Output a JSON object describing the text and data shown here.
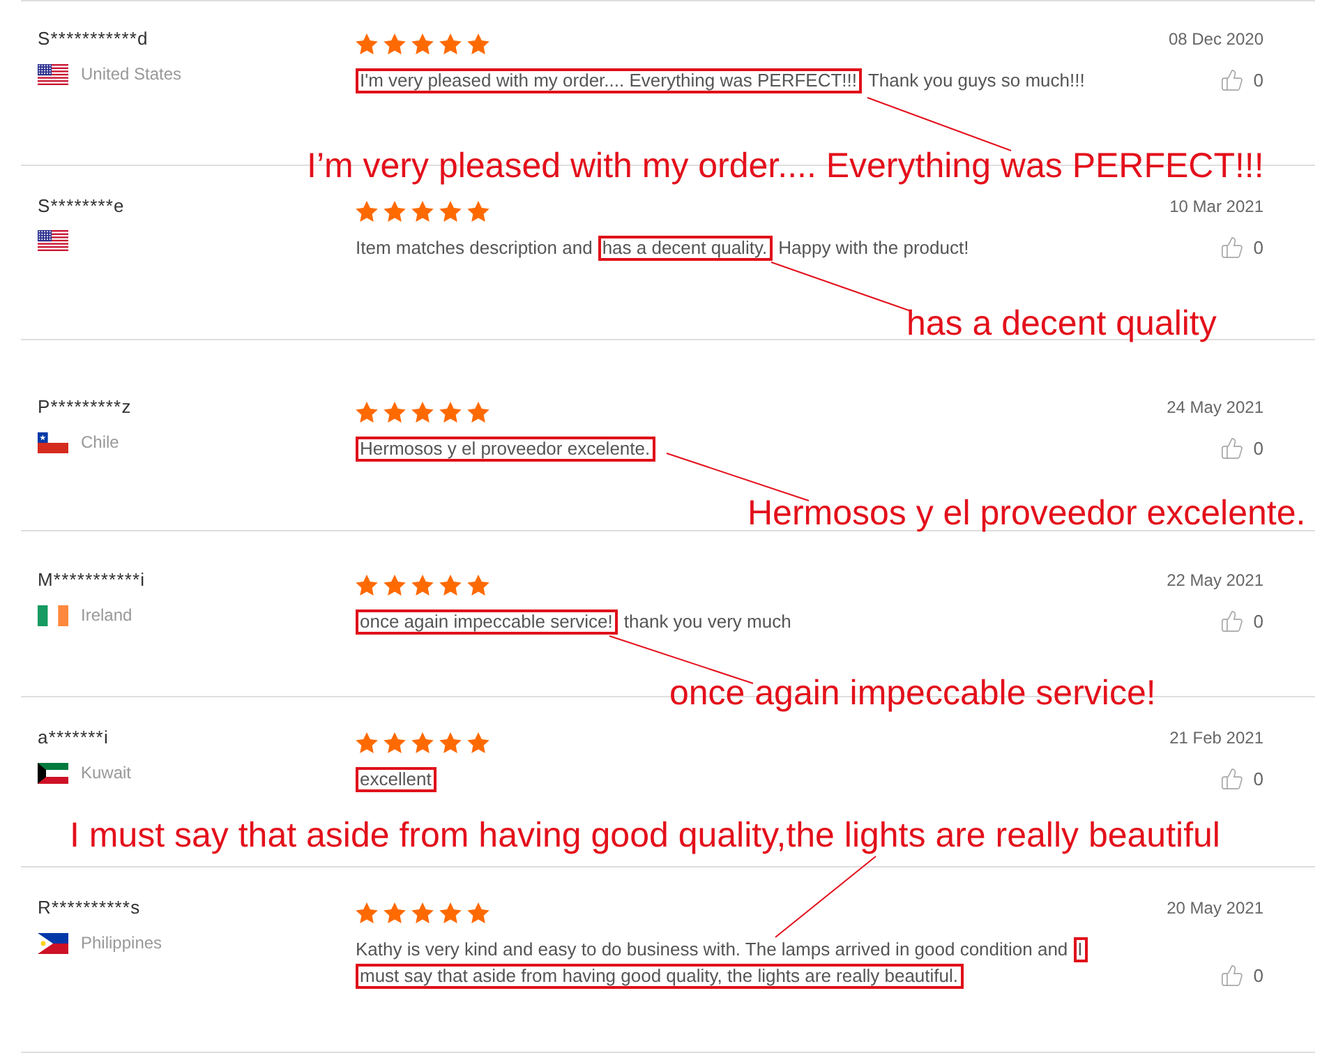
{
  "reviews": [
    {
      "name": "S***********d",
      "country": "United States",
      "stars": 5,
      "date": "08 Dec 2020",
      "body": [
        {
          "text": "I'm very pleased with my order.... Everything was PERFECT!!!",
          "highlighted": true
        },
        {
          "text": "Thank you guys so much!!!",
          "highlighted": false
        }
      ],
      "likes": "0",
      "callout": "I’m very pleased with my order.... Everything was PERFECT!!!"
    },
    {
      "name": "S********e",
      "stars": 5,
      "date": "10 Mar 2021",
      "body": [
        {
          "text": "Item matches description and",
          "highlighted": false
        },
        {
          "text": "has a decent quality.",
          "highlighted": true
        },
        {
          "text": "Happy with the product!",
          "highlighted": false
        }
      ],
      "likes": "0",
      "callout": "has a decent quality"
    },
    {
      "name": "P*********z",
      "country": "Chile",
      "stars": 5,
      "date": "24 May 2021",
      "body": [
        {
          "text": "Hermosos y el proveedor excelente.",
          "highlighted": true
        }
      ],
      "likes": "0",
      "callout": "Hermosos y el proveedor excelente."
    },
    {
      "name": "M***********i",
      "country": "Ireland",
      "stars": 5,
      "date": "22 May 2021",
      "body": [
        {
          "text": "once again impeccable service!",
          "highlighted": true
        },
        {
          "text": "thank you very much",
          "highlighted": false
        }
      ],
      "likes": "0",
      "callout": "once again impeccable service!"
    },
    {
      "name": "a*******i",
      "country": "Kuwait",
      "stars": 5,
      "date": "21 Feb 2021",
      "body": [
        {
          "text": "excellent",
          "highlighted": true
        }
      ],
      "likes": "0"
    },
    {
      "name": "R**********s",
      "country": "Philippines",
      "stars": 5,
      "date": "20 May 2021",
      "body": [
        {
          "text": "Kathy is very kind and easy to do business with. The lamps arrived in good condition and",
          "highlighted": false
        },
        {
          "text": "I",
          "highlighted": true
        },
        {
          "text": "must say that aside from having good quality, the lights are really beautiful.",
          "highlighted": true
        }
      ],
      "likes": "0",
      "callout": "I must say that aside from having good quality,the lights are really beautiful"
    }
  ]
}
